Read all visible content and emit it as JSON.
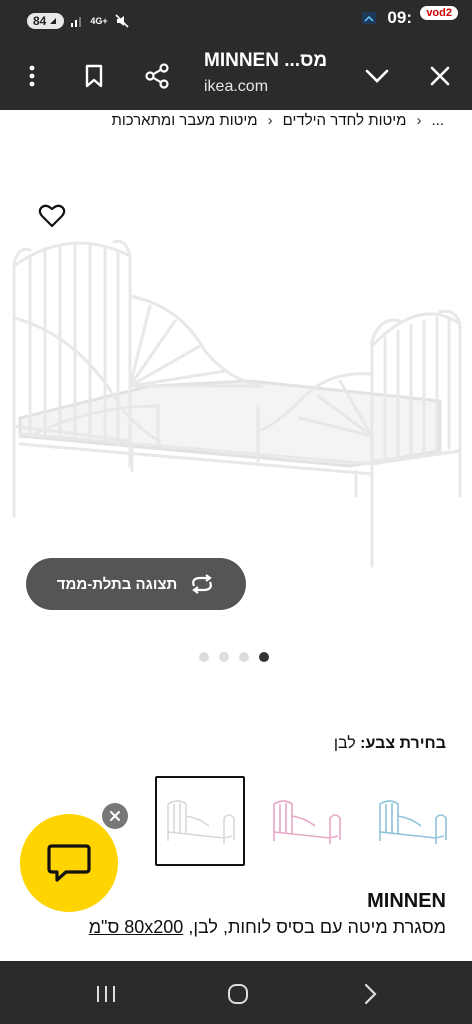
{
  "status_bar": {
    "battery": "84",
    "network": "4G+",
    "time": "09:",
    "carrier_badge": "vod2"
  },
  "toolbar": {
    "title": "MINNEN ...מס",
    "url": "ikea.com",
    "icons": [
      "more-vert-icon",
      "bookmark-icon",
      "share-icon",
      "chevron-down-icon",
      "close-icon"
    ]
  },
  "breadcrumb": {
    "items": [
      "...",
      "מיטות לחדר הילדים",
      "מיטות מעבר ומתארכות"
    ]
  },
  "product_image": {
    "view_3d_label": "תצוגה בתלת-ממד",
    "dots_count": 4,
    "active_dot": 3
  },
  "color": {
    "label": "בחירת צבע:",
    "value": "לבן",
    "swatches": [
      {
        "name": "white",
        "color": "#d8d8d8",
        "selected": true
      },
      {
        "name": "pink",
        "color": "#e6a7c6",
        "selected": false
      },
      {
        "name": "blue",
        "color": "#8fc3d9",
        "selected": false
      }
    ]
  },
  "product": {
    "name": "MINNEN",
    "description": "מסגרת מיטה עם בסיס לוחות, לבן,",
    "size": "80x200 ס\"מ"
  },
  "colors": {
    "system_bar": "#2b2b2b",
    "chat_fab": "#ffd400",
    "view_3d_button": "#555555"
  }
}
